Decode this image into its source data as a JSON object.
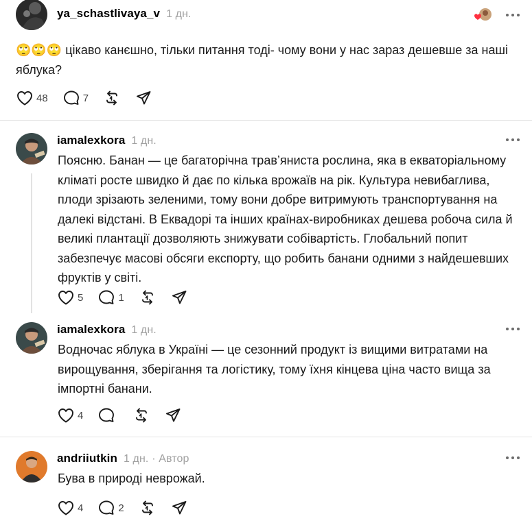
{
  "posts": [
    {
      "username": "ya_schastlivaya_v",
      "time": "1 дн.",
      "text": "🙄🙄🙄 цікаво канєшно, тільки питання тоді- чому вони у нас зараз дешевше за наші яблука?",
      "likes": "48",
      "replies": "7"
    },
    {
      "username": "iamalexkora",
      "time": "1 дн.",
      "text": "Поясню. Банан — це багаторічна трав’яниста рослина, яка в екваторіальному кліматі росте швидко й дає по кілька врожаїв на рік. Культура невибаглива, плоди зрізають зеленими, тому вони добре витримують транспортування на далекі відстані. В Еквадорі та інших країнах-виробниках дешева робоча сила й великі плантації дозволяють знижувати собівартість. Глобальний попит забезпечує масові обсяги експорту, що робить банани одними з найдешевших фруктів у світі.",
      "likes": "5",
      "replies": "1"
    },
    {
      "username": "iamalexkora",
      "time": "1 дн.",
      "text": "Водночас яблука в Україні — це сезонний продукт із вищими витратами на вирощування, зберігання та логістику, тому їхня кінцева ціна часто вища за імпортні банани.",
      "likes": "4",
      "replies": ""
    },
    {
      "username": "andriiutkin",
      "time": "1 дн.",
      "author_badge": "· Автор",
      "text": "Бува в природі неврожай.",
      "likes": "4",
      "replies": "2"
    }
  ],
  "icons": {
    "like": "heart-icon",
    "reply": "comment-icon",
    "repost": "repost-icon",
    "share": "send-icon",
    "more": "more-icon"
  },
  "colors": {
    "text": "#1a1a1a",
    "muted": "#a0a0a0",
    "divider": "#e4e4e4",
    "reaction_red": "#ff3040"
  }
}
